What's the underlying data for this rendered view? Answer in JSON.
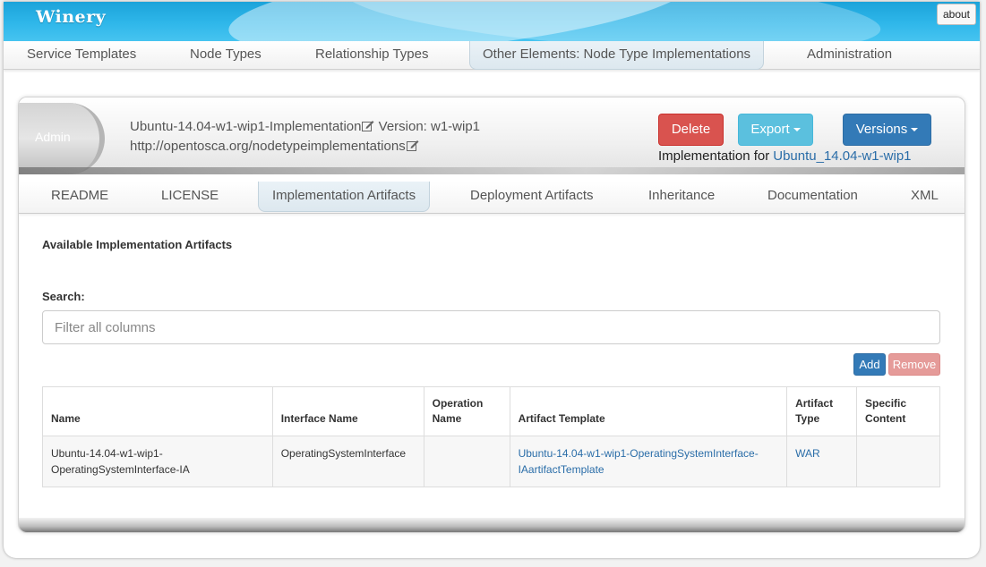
{
  "app": {
    "brand": "Winery",
    "about_label": "about"
  },
  "main_nav": {
    "tabs": [
      {
        "label": "Service Templates"
      },
      {
        "label": "Node Types"
      },
      {
        "label": "Relationship Types"
      },
      {
        "label": "Other Elements: Node Type Implementations",
        "active": true
      },
      {
        "label": "Administration"
      }
    ]
  },
  "header": {
    "badge_label": "Admin",
    "name": "Ubuntu-14.04-w1-wip1-Implementation",
    "version_text": "Version: w1-wip1",
    "namespace": "http://opentosca.org/nodetypeimplementations",
    "delete_label": "Delete",
    "export_label": "Export",
    "versions_label": "Versions",
    "implementation_for_label": "Implementation for",
    "implementation_for_link": "Ubuntu_14.04-w1-wip1"
  },
  "sub_nav": {
    "tabs": [
      {
        "label": "README"
      },
      {
        "label": "LICENSE"
      },
      {
        "label": "Implementation Artifacts",
        "active": true
      },
      {
        "label": "Deployment Artifacts"
      },
      {
        "label": "Inheritance"
      },
      {
        "label": "Documentation"
      },
      {
        "label": "XML"
      }
    ]
  },
  "artifacts": {
    "section_title": "Available Implementation Artifacts",
    "search_label": "Search:",
    "search_placeholder": "Filter all columns",
    "search_value": "",
    "add_label": "Add",
    "remove_label": "Remove",
    "columns": [
      "Name",
      "Interface Name",
      "Operation Name",
      "Artifact Template",
      "Artifact Type",
      "Specific Content"
    ],
    "rows": [
      {
        "name": "Ubuntu-14.04-w1-wip1-OperatingSystemInterface-IA",
        "interface_name": "OperatingSystemInterface",
        "operation_name": "",
        "artifact_template": "Ubuntu-14.04-w1-wip1-OperatingSystemInterface-IAartifactTemplate",
        "artifact_type": "WAR",
        "specific_content": ""
      }
    ]
  },
  "colors": {
    "banner": "#1ba3da",
    "danger": "#d9534f",
    "info": "#5bc0de",
    "primary": "#337ab7",
    "link": "#2a6da8"
  }
}
